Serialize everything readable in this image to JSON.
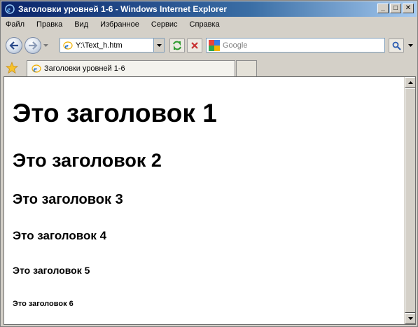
{
  "window": {
    "title": "Заголовки уровней 1-6 - Windows Internet Explorer",
    "controls": {
      "minimize": "_",
      "maximize": "□",
      "close": "✕"
    }
  },
  "menu": {
    "items": [
      {
        "label": "Файл"
      },
      {
        "label": "Правка"
      },
      {
        "label": "Вид"
      },
      {
        "label": "Избранное"
      },
      {
        "label": "Сервис"
      },
      {
        "label": "Справка"
      }
    ]
  },
  "nav": {
    "back_icon": "back-arrow-icon",
    "forward_icon": "forward-arrow-icon",
    "address": "Y:\\Text_h.htm",
    "search_placeholder": "Google"
  },
  "tabs": {
    "active_label": "Заголовки уровней 1-6"
  },
  "page": {
    "h1": "Это заголовок 1",
    "h2": "Это заголовок 2",
    "h3": "Это заголовок 3",
    "h4": "Это заголовок 4",
    "h5": "Это заголовок 5",
    "h6": "Это заголовок 6"
  },
  "colors": {
    "titlebar_start": "#0a246a",
    "titlebar_end": "#a6caf0",
    "chrome": "#d4d0c8",
    "content_bg": "#ffffff"
  }
}
